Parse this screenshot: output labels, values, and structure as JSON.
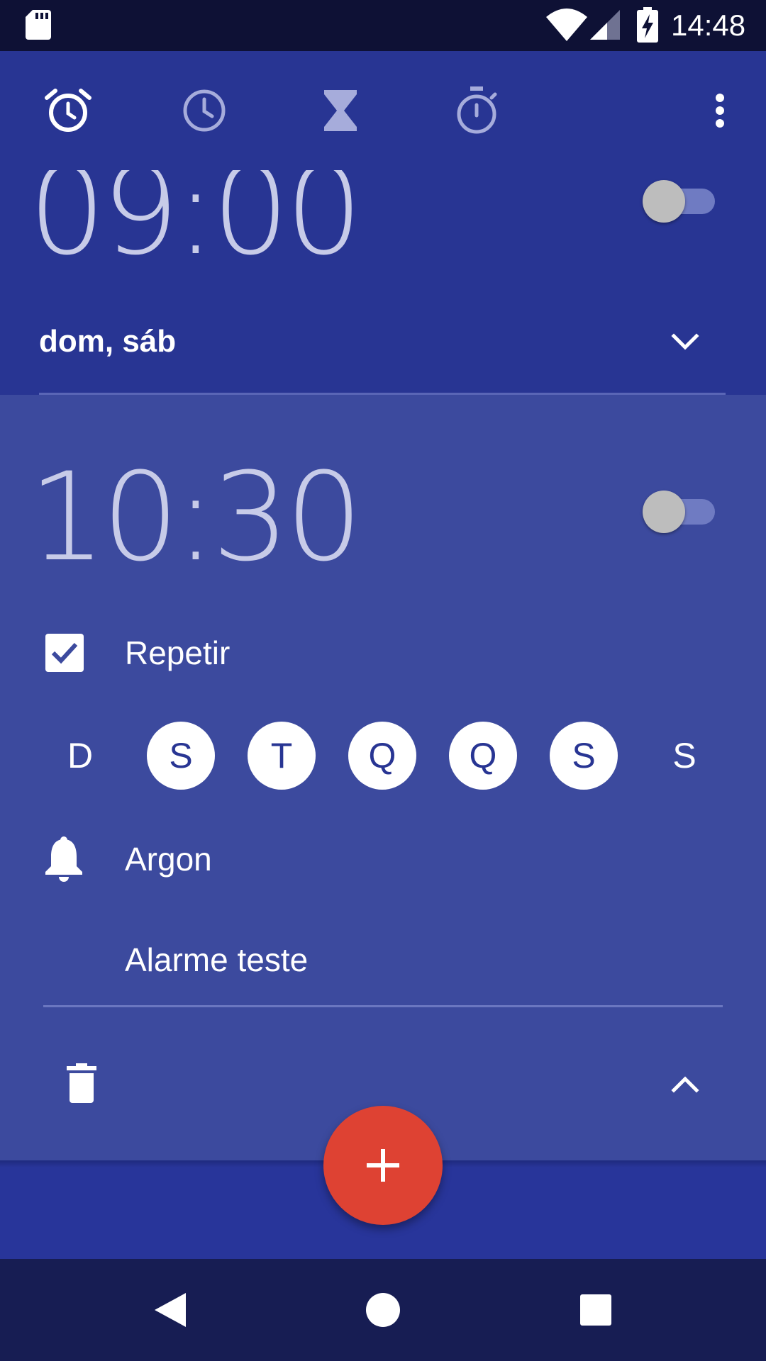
{
  "status_bar": {
    "time": "14:48"
  },
  "toolbar": {
    "tabs": [
      {
        "name": "alarm",
        "icon": "alarm-icon",
        "selected": true
      },
      {
        "name": "clock",
        "icon": "clock-icon",
        "selected": false
      },
      {
        "name": "timer",
        "icon": "hourglass-icon",
        "selected": false
      },
      {
        "name": "stopwatch",
        "icon": "stopwatch-icon",
        "selected": false
      }
    ],
    "overflow_icon": "more-vert-icon"
  },
  "alarms": [
    {
      "time": "09:00",
      "enabled": false,
      "days_summary": "dom, sáb",
      "expanded": false
    },
    {
      "time": "10:30",
      "enabled": false,
      "expanded": true,
      "repeat": {
        "label": "Repetir",
        "checked": true
      },
      "days": [
        {
          "letter": "D",
          "on": false
        },
        {
          "letter": "S",
          "on": true
        },
        {
          "letter": "T",
          "on": true
        },
        {
          "letter": "Q",
          "on": true
        },
        {
          "letter": "Q",
          "on": true
        },
        {
          "letter": "S",
          "on": true
        },
        {
          "letter": "S",
          "on": false
        }
      ],
      "ringtone": "Argon",
      "label": "Alarme teste"
    }
  ],
  "fab": {
    "icon": "plus-icon"
  },
  "colors": {
    "primary": "#283593",
    "card_expanded": "#3c4a9e",
    "accent": "#de4233",
    "status_bar": "#0e1135",
    "nav_bar": "#171d53"
  }
}
